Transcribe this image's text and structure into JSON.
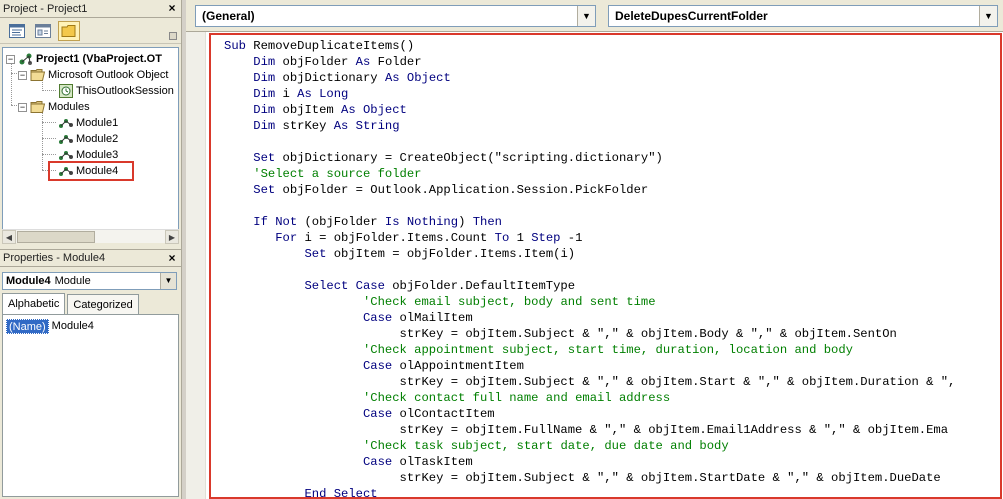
{
  "project": {
    "title": "Project - Project1",
    "close": "×",
    "tree": {
      "root": "Project1 (VbaProject.OT",
      "folder_objects": "Microsoft Outlook Object",
      "this_session": "ThisOutlookSession",
      "folder_modules": "Modules",
      "modules": [
        "Module1",
        "Module2",
        "Module3",
        "Module4"
      ],
      "expanded_glyph": "−"
    }
  },
  "properties": {
    "title": "Properties - Module4",
    "close": "×",
    "object_name": "Module4",
    "object_type": "Module",
    "tabs": [
      "Alphabetic",
      "Categorized"
    ],
    "row": {
      "name": "(Name)",
      "value": "Module4"
    }
  },
  "editor": {
    "object_combo": "(General)",
    "procedure_combo": "DeleteDupesCurrentFolder",
    "combo_arrow": "▼",
    "lines": [
      [
        [
          "kw",
          "Sub "
        ],
        [
          "tx",
          "RemoveDuplicateItems()"
        ]
      ],
      [
        [
          "tx",
          "    "
        ],
        [
          "kw",
          "Dim "
        ],
        [
          "tx",
          "objFolder "
        ],
        [
          "kw",
          "As "
        ],
        [
          "tx",
          "Folder"
        ]
      ],
      [
        [
          "tx",
          "    "
        ],
        [
          "kw",
          "Dim "
        ],
        [
          "tx",
          "objDictionary "
        ],
        [
          "kw",
          "As Object"
        ]
      ],
      [
        [
          "tx",
          "    "
        ],
        [
          "kw",
          "Dim "
        ],
        [
          "tx",
          "i "
        ],
        [
          "kw",
          "As Long"
        ]
      ],
      [
        [
          "tx",
          "    "
        ],
        [
          "kw",
          "Dim "
        ],
        [
          "tx",
          "objItem "
        ],
        [
          "kw",
          "As Object"
        ]
      ],
      [
        [
          "tx",
          "    "
        ],
        [
          "kw",
          "Dim "
        ],
        [
          "tx",
          "strKey "
        ],
        [
          "kw",
          "As String"
        ]
      ],
      [
        [
          "tx",
          ""
        ]
      ],
      [
        [
          "tx",
          "    "
        ],
        [
          "kw",
          "Set "
        ],
        [
          "tx",
          "objDictionary = CreateObject(\"scripting.dictionary\")"
        ]
      ],
      [
        [
          "tx",
          "    "
        ],
        [
          "cm",
          "'Select a source folder"
        ]
      ],
      [
        [
          "tx",
          "    "
        ],
        [
          "kw",
          "Set "
        ],
        [
          "tx",
          "objFolder = Outlook.Application.Session.PickFolder"
        ]
      ],
      [
        [
          "tx",
          ""
        ]
      ],
      [
        [
          "tx",
          "    "
        ],
        [
          "kw",
          "If Not "
        ],
        [
          "tx",
          "(objFolder "
        ],
        [
          "kw",
          "Is Nothing"
        ],
        [
          "tx",
          ") "
        ],
        [
          "kw",
          "Then"
        ]
      ],
      [
        [
          "tx",
          "       "
        ],
        [
          "kw",
          "For "
        ],
        [
          "tx",
          "i = objFolder.Items.Count "
        ],
        [
          "kw",
          "To "
        ],
        [
          "tx",
          "1 "
        ],
        [
          "kw",
          "Step "
        ],
        [
          "tx",
          "-1"
        ]
      ],
      [
        [
          "tx",
          "           "
        ],
        [
          "kw",
          "Set "
        ],
        [
          "tx",
          "objItem = objFolder.Items.Item(i)"
        ]
      ],
      [
        [
          "tx",
          ""
        ]
      ],
      [
        [
          "tx",
          "           "
        ],
        [
          "kw",
          "Select Case "
        ],
        [
          "tx",
          "objFolder.DefaultItemType"
        ]
      ],
      [
        [
          "tx",
          "                   "
        ],
        [
          "cm",
          "'Check email subject, body and sent time"
        ]
      ],
      [
        [
          "tx",
          "                   "
        ],
        [
          "kw",
          "Case "
        ],
        [
          "tx",
          "olMailItem"
        ]
      ],
      [
        [
          "tx",
          "                        strKey = objItem.Subject & \",\" & objItem.Body & \",\" & objItem.SentOn"
        ]
      ],
      [
        [
          "tx",
          "                   "
        ],
        [
          "cm",
          "'Check appointment subject, start time, duration, location and body"
        ]
      ],
      [
        [
          "tx",
          "                   "
        ],
        [
          "kw",
          "Case "
        ],
        [
          "tx",
          "olAppointmentItem"
        ]
      ],
      [
        [
          "tx",
          "                        strKey = objItem.Subject & \",\" & objItem.Start & \",\" & objItem.Duration & \","
        ]
      ],
      [
        [
          "tx",
          "                   "
        ],
        [
          "cm",
          "'Check contact full name and email address"
        ]
      ],
      [
        [
          "tx",
          "                   "
        ],
        [
          "kw",
          "Case "
        ],
        [
          "tx",
          "olContactItem"
        ]
      ],
      [
        [
          "tx",
          "                        strKey = objItem.FullName & \",\" & objItem.Email1Address & \",\" & objItem.Ema"
        ]
      ],
      [
        [
          "tx",
          "                   "
        ],
        [
          "cm",
          "'Check task subject, start date, due date and body"
        ]
      ],
      [
        [
          "tx",
          "                   "
        ],
        [
          "kw",
          "Case "
        ],
        [
          "tx",
          "olTaskItem"
        ]
      ],
      [
        [
          "tx",
          "                        strKey = objItem.Subject & \",\" & objItem.StartDate & \",\" & objItem.DueDate"
        ]
      ],
      [
        [
          "tx",
          "           "
        ],
        [
          "kw",
          "End Select"
        ]
      ]
    ]
  },
  "colors": {
    "keyword": "#00007f",
    "comment": "#007f00",
    "highlight": "#d9392b"
  }
}
